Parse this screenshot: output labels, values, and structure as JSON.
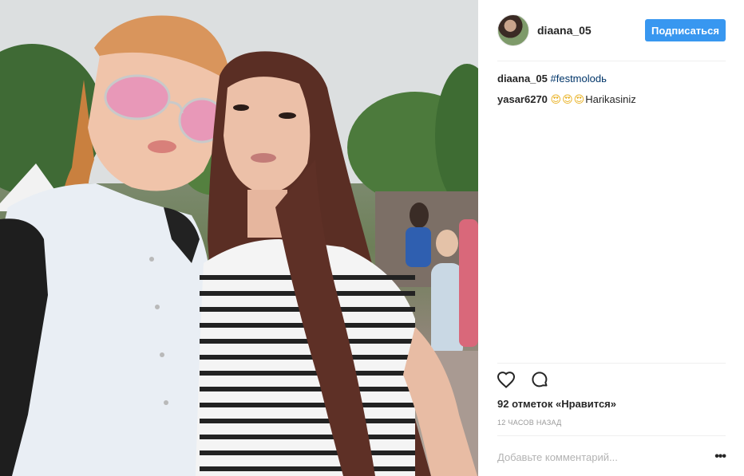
{
  "post": {
    "username": "diaana_05",
    "follow_label": "Подписаться",
    "avatar_alt": "diaana_05",
    "comments": [
      {
        "author": "diaana_05",
        "hashtag": "#festmolodь",
        "text": "",
        "emoji": ""
      },
      {
        "author": "yasar6270",
        "hashtag": "",
        "emoji": "😍😍😍",
        "text": "Harikasiniz"
      }
    ],
    "likes_text": "92 отметок «Нравится»",
    "timestamp": "12 часов назад",
    "comment_placeholder": "Добавьте комментарий...",
    "more_label": "•••",
    "icons": {
      "like": "heart-icon",
      "comment": "comment-bubble-icon",
      "more": "more-options-icon"
    },
    "colors": {
      "follow": "#3897f0",
      "hashtag": "#003569",
      "muted": "#999999"
    }
  }
}
